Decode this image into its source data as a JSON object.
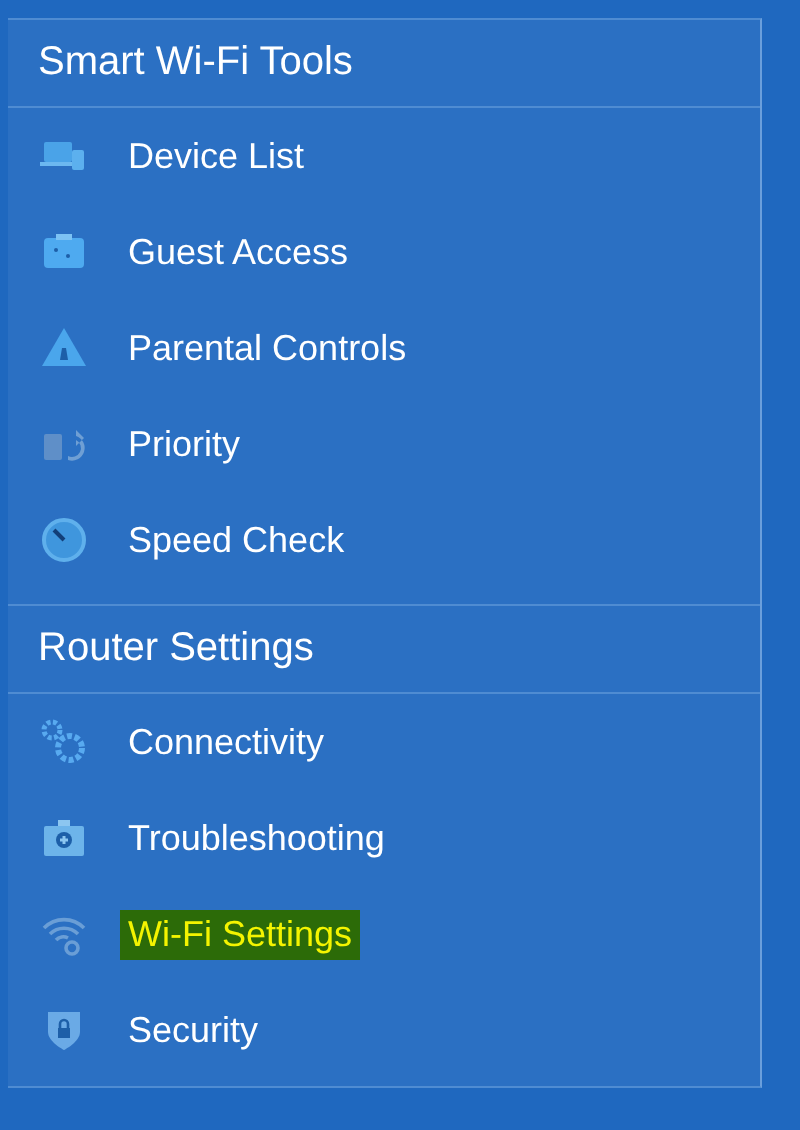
{
  "sections": [
    {
      "title": "Smart Wi-Fi Tools",
      "items": [
        {
          "label": "Device List",
          "highlighted": false
        },
        {
          "label": "Guest Access",
          "highlighted": false
        },
        {
          "label": "Parental Controls",
          "highlighted": false
        },
        {
          "label": "Priority",
          "highlighted": false
        },
        {
          "label": "Speed Check",
          "highlighted": false
        }
      ]
    },
    {
      "title": "Router Settings",
      "items": [
        {
          "label": "Connectivity",
          "highlighted": false
        },
        {
          "label": "Troubleshooting",
          "highlighted": false
        },
        {
          "label": "Wi-Fi Settings",
          "highlighted": true
        },
        {
          "label": "Security",
          "highlighted": false
        }
      ]
    }
  ]
}
